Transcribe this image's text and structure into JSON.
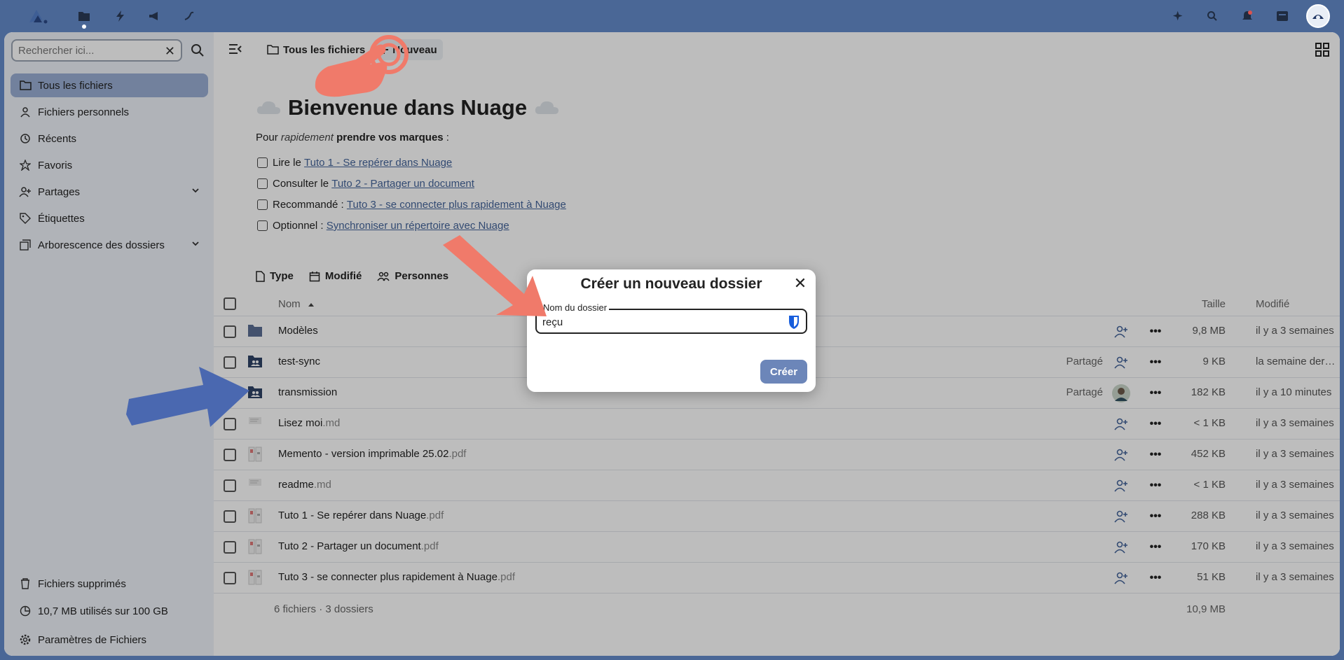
{
  "topbar": {
    "apps": [
      "files-icon",
      "activity-icon",
      "announcements-icon",
      "forms-icon"
    ],
    "right": [
      "assistant-icon",
      "search-icon",
      "notifications-icon",
      "contacts-icon"
    ]
  },
  "sidebar": {
    "search_placeholder": "Rechercher ici...",
    "items": [
      {
        "label": "Tous les fichiers",
        "icon": "folder-icon",
        "active": true
      },
      {
        "label": "Fichiers personnels",
        "icon": "account-icon"
      },
      {
        "label": "Récents",
        "icon": "history-icon"
      },
      {
        "label": "Favoris",
        "icon": "star-icon"
      },
      {
        "label": "Partages",
        "icon": "share-icon",
        "expandable": true
      },
      {
        "label": "Étiquettes",
        "icon": "tag-icon"
      },
      {
        "label": "Arborescence des dossiers",
        "icon": "tree-icon",
        "expandable": true
      }
    ],
    "deleted": "Fichiers supprimés",
    "quota": "10,7 MB utilisés sur 100 GB",
    "settings": "Paramètres de Fichiers"
  },
  "breadcrumb": {
    "root": "Tous les fichiers",
    "new": "Nouveau"
  },
  "welcome": {
    "title": "Bienvenue dans Nuage",
    "sub_prefix": "Pour ",
    "sub_em": "rapidement",
    "sub_bold": "prendre vos marques",
    "sub_suffix": " :",
    "tasks": [
      {
        "prefix": "Lire le ",
        "link": "Tuto 1 - Se repérer dans Nuage"
      },
      {
        "prefix": "Consulter le ",
        "link": "Tuto 2 - Partager un document"
      },
      {
        "prefix": "Recommandé : ",
        "link": "Tuto 3 - se connecter plus rapidement à Nuage"
      },
      {
        "prefix": "Optionnel : ",
        "link": "Synchroniser un répertoire avec Nuage"
      }
    ]
  },
  "filters": {
    "type": "Type",
    "modified": "Modifié",
    "people": "Personnes"
  },
  "table": {
    "col_name": "Nom",
    "col_size": "Taille",
    "col_modified": "Modifié",
    "rows": [
      {
        "name": "Modèles",
        "ext": "",
        "type": "folder",
        "shared": "",
        "size": "9,8 MB",
        "modified": "il y a 3 semaines"
      },
      {
        "name": "test-sync",
        "ext": "",
        "type": "shared-folder",
        "shared": "Partagé",
        "size": "9 KB",
        "modified": "la semaine dernière"
      },
      {
        "name": "transmission",
        "ext": "",
        "type": "shared-folder",
        "shared": "Partagé",
        "size": "182 KB",
        "modified": "il y a 10 minutes",
        "avatar": true
      },
      {
        "name": "Lisez moi",
        "ext": ".md",
        "type": "file",
        "shared": "",
        "size": "< 1 KB",
        "modified": "il y a 3 semaines"
      },
      {
        "name": "Memento - version imprimable 25.02",
        "ext": ".pdf",
        "type": "pdf",
        "shared": "",
        "size": "452 KB",
        "modified": "il y a 3 semaines"
      },
      {
        "name": "readme",
        "ext": ".md",
        "type": "file",
        "shared": "",
        "size": "< 1 KB",
        "modified": "il y a 3 semaines"
      },
      {
        "name": "Tuto 1 - Se repérer dans Nuage",
        "ext": ".pdf",
        "type": "pdf",
        "shared": "",
        "size": "288 KB",
        "modified": "il y a 3 semaines"
      },
      {
        "name": "Tuto 2 - Partager un document",
        "ext": ".pdf",
        "type": "pdf",
        "shared": "",
        "size": "170 KB",
        "modified": "il y a 3 semaines"
      },
      {
        "name": "Tuto 3 - se connecter plus rapidement à Nuage",
        "ext": ".pdf",
        "type": "pdf",
        "shared": "",
        "size": "51 KB",
        "modified": "il y a 3 semaines"
      }
    ],
    "summary": "6 fichiers · 3 dossiers",
    "summary_size": "10,9 MB"
  },
  "dialog": {
    "title": "Créer un nouveau dossier",
    "field_label": "Nom du dossier",
    "value": "reçu",
    "create": "Créer"
  },
  "colors": {
    "brand": "#4a6796",
    "accent_button": "#6c86b9",
    "active_nav": "#9aafd4",
    "annotation_red": "#f07a6a",
    "annotation_blue": "#4a68b0"
  }
}
